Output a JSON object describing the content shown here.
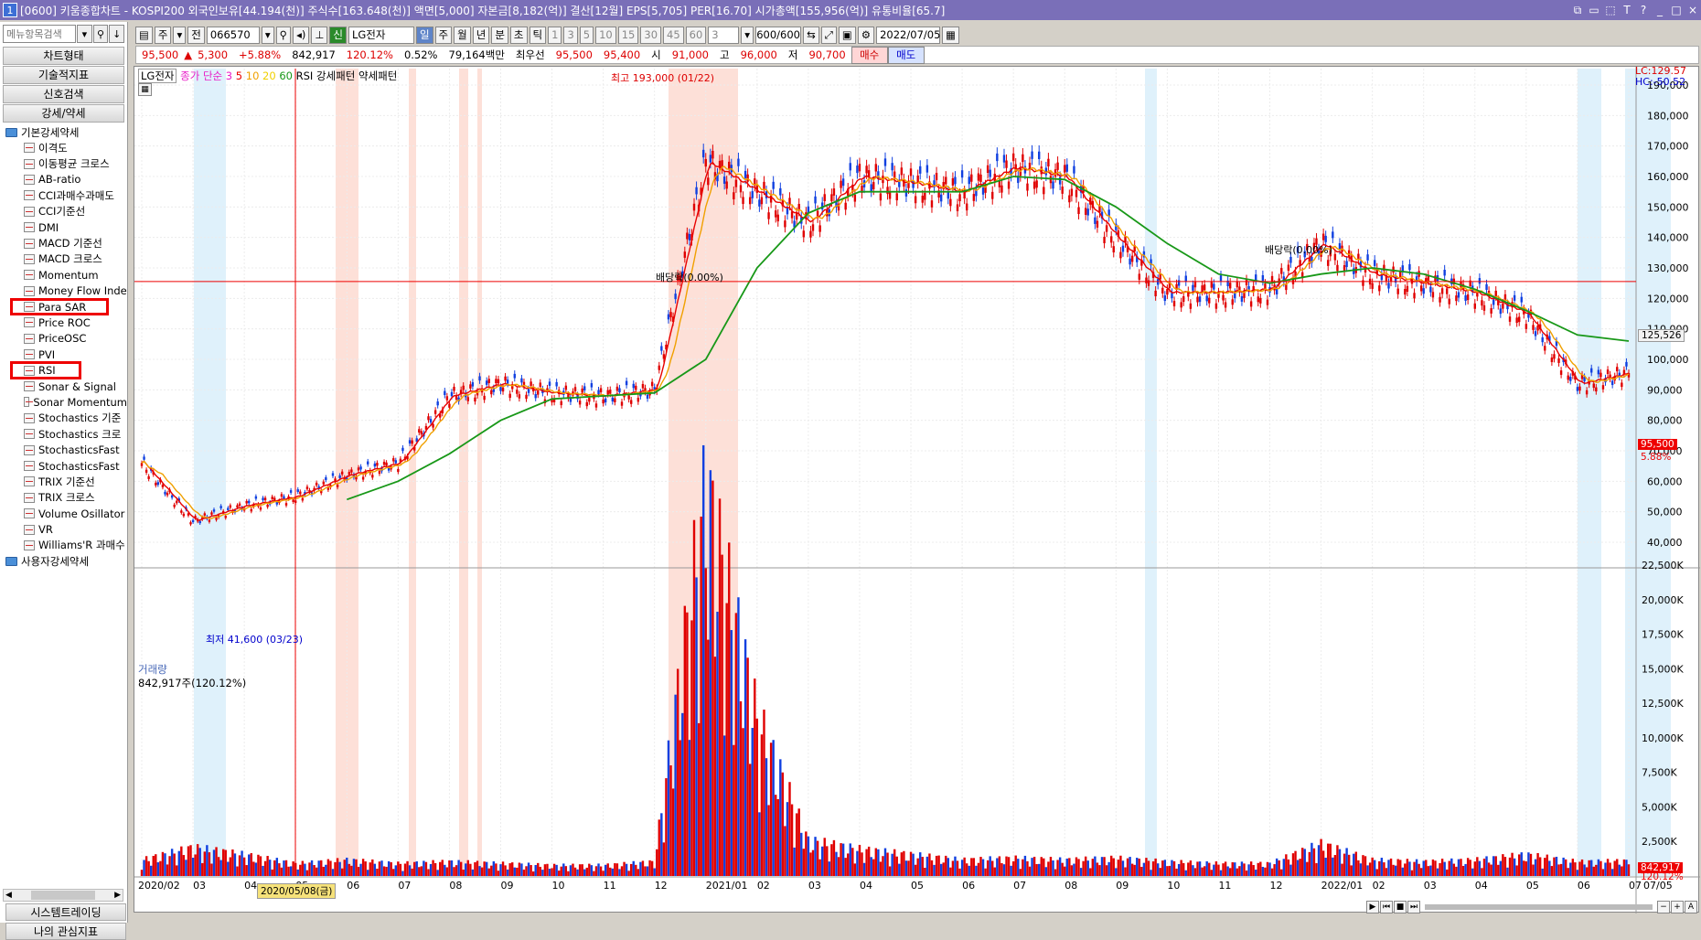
{
  "title_bar": {
    "num": "1",
    "text": "[0600] 키움종합차트 - KOSPI200 외국인보유[44.194(천)] 주식수[163.648(천)] 액면[5,000] 자본금[8,182(억)] 결산[12월] EPS[5,705] PER[16.70] 시가총액[155,956(억)] 유통비율[65.7]",
    "icons": [
      "restore-icon",
      "tile-icon",
      "resize-icon",
      "font-icon",
      "help-icon",
      "minimize-icon",
      "maximize-icon",
      "close-icon"
    ]
  },
  "sidebar": {
    "search_placeholder": "메뉴항목검색",
    "tabs": [
      "차트형태",
      "기술적지표",
      "신호검색",
      "강세/약세"
    ],
    "root_folder": "기본강세약세",
    "items": [
      "이격도",
      "이동평균 크로스",
      "AB-ratio",
      "CCI과매수과매도",
      "CCI기준선",
      "DMI",
      "MACD 기준선",
      "MACD 크로스",
      "Momentum",
      "Money Flow Inde",
      "Para SAR",
      "Price ROC",
      "PriceOSC",
      "PVI",
      "RSI",
      "Sonar & Signal",
      "Sonar Momentum",
      "Stochastics 기준",
      "Stochastics 크로",
      "StochasticsFast",
      "StochasticsFast",
      "TRIX 기준선",
      "TRIX 크로스",
      "Volume Osillator",
      "VR",
      "Williams'R 과매수"
    ],
    "highlighted": [
      "Para SAR",
      "RSI"
    ],
    "user_folder": "사용자강세약세",
    "bottom_tabs": [
      "시스템트레이딩",
      "나의 관심지표"
    ]
  },
  "toolbar1": {
    "ju": "주",
    "jeon": "전",
    "code": "066570",
    "badge": "신",
    "name": "LG전자",
    "periods": [
      "일",
      "주",
      "월",
      "년",
      "분",
      "초",
      "틱"
    ],
    "active_period": "일",
    "minutes": [
      "1",
      "3",
      "5",
      "10",
      "15",
      "30",
      "45",
      "60"
    ],
    "custom": "3",
    "count": "600/600",
    "date": "2022/07/05"
  },
  "toolbar2": {
    "price": "95,500",
    "arrow": "▲",
    "change": "5,300",
    "pct": "+5.88%",
    "volume": "842,917",
    "vol_pct": "120.12%",
    "turnover": "0.52%",
    "amount": "79,164백만",
    "best": "최우선",
    "bid": "95,500",
    "ask": "95,400",
    "open_l": "시",
    "open": "91,000",
    "high_l": "고",
    "high": "96,000",
    "low_l": "저",
    "low": "90,700",
    "buy": "매수",
    "sell": "매도"
  },
  "legend": {
    "stock": "LG전자",
    "ma_label": "종가 단순",
    "ma": [
      "3",
      "5",
      "10",
      "20",
      "60"
    ],
    "ma_colors": [
      "#e81ec8",
      "#e80000",
      "#f0a000",
      "#f0d000",
      "#189818"
    ],
    "patterns": "RSI 강세패턴  약세패턴"
  },
  "annotations": {
    "high": "최고 193,000 (01/22)",
    "low": "최저 41,600 (03/23)",
    "div1": "배당락(0.00%)",
    "div2": "배당락(0.00%)"
  },
  "axis": {
    "lc": "LC:129.57",
    "hc": "HC:-50.52",
    "price_ticks": [
      "190,000",
      "180,000",
      "170,000",
      "160,000",
      "150,000",
      "140,000",
      "130,000",
      "120,000",
      "110,000",
      "100,000",
      "90,000",
      "80,000",
      "70,000",
      "60,000",
      "50,000",
      "40,000"
    ],
    "cursor_price": "125,526",
    "last_price": "95,500",
    "last_pct": "5.88%",
    "vol_ticks": [
      "22,500K",
      "20,000K",
      "17,500K",
      "15,000K",
      "12,500K",
      "10,000K",
      "7,500K",
      "5,000K",
      "2,500K"
    ],
    "vol_last": "842,917",
    "vol_pct": "120.12%",
    "dates": [
      "2020/02",
      "03",
      "04",
      "05",
      "06",
      "07",
      "08",
      "09",
      "10",
      "11",
      "12",
      "2021/01",
      "02",
      "03",
      "04",
      "05",
      "06",
      "07",
      "08",
      "09",
      "10",
      "11",
      "12",
      "2022/01",
      "02",
      "03",
      "04",
      "05",
      "06",
      "07",
      "07/05"
    ],
    "cursor_date": "2020/05/08(금)"
  },
  "volume_panel": {
    "title": "거래량",
    "value": "842,917주(120.12%)"
  },
  "chart_data": {
    "type": "candlestick-with-volume",
    "symbol": "LG전자 066570",
    "x": [
      "2020/02",
      "2020/03",
      "2020/04",
      "2020/05",
      "2020/06",
      "2020/07",
      "2020/08",
      "2020/09",
      "2020/10",
      "2020/11",
      "2020/12",
      "2021/01",
      "2021/02",
      "2021/03",
      "2021/04",
      "2021/05",
      "2021/06",
      "2021/07",
      "2021/08",
      "2021/09",
      "2021/10",
      "2021/11",
      "2021/12",
      "2022/01",
      "2022/02",
      "2022/03",
      "2022/04",
      "2022/05",
      "2022/06",
      "2022/07"
    ],
    "close": [
      66000,
      47000,
      52000,
      55000,
      62000,
      66000,
      88000,
      92000,
      89000,
      88000,
      90000,
      165000,
      155000,
      145000,
      160000,
      158000,
      155000,
      163000,
      160000,
      140000,
      122000,
      122000,
      123000,
      138000,
      128000,
      125000,
      122000,
      115000,
      92000,
      95500
    ],
    "ma60": [
      null,
      null,
      null,
      null,
      54000,
      60000,
      69000,
      80000,
      87000,
      88000,
      89000,
      100000,
      130000,
      148000,
      155000,
      155000,
      155000,
      160000,
      159000,
      150000,
      138000,
      128000,
      125000,
      128000,
      130000,
      128000,
      123000,
      116000,
      108000,
      106000
    ],
    "volume_k": [
      900,
      1600,
      1200,
      700,
      900,
      700,
      800,
      700,
      600,
      600,
      800,
      22000,
      9000,
      2000,
      1500,
      1200,
      900,
      1000,
      900,
      1000,
      800,
      700,
      700,
      1800,
      900,
      800,
      900,
      1200,
      800,
      843
    ],
    "ylim": [
      40000,
      190000
    ],
    "vol_ylim": [
      0,
      22500
    ]
  }
}
